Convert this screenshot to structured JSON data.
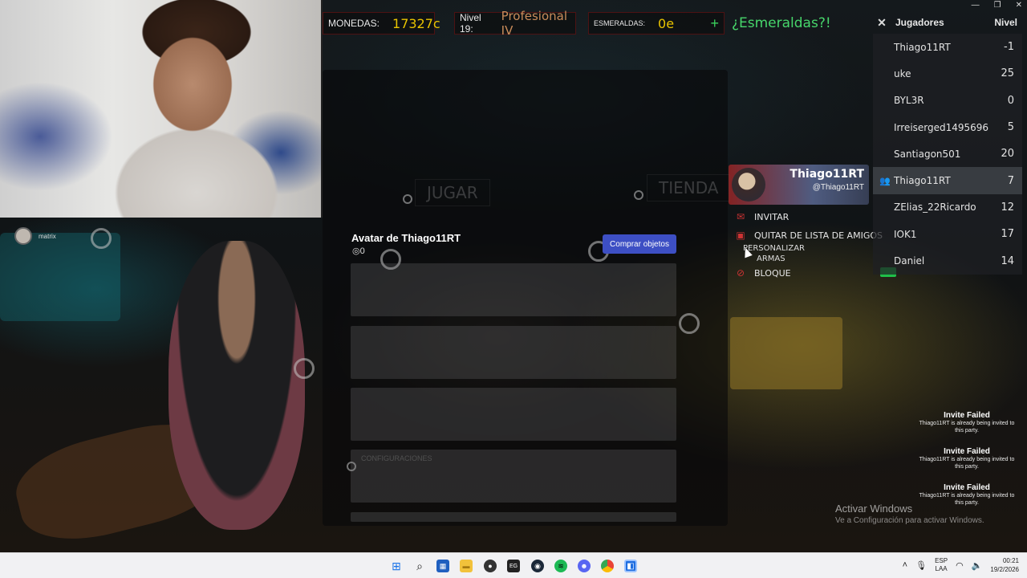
{
  "hud": {
    "coins_label": "MONEDAS:",
    "coins_value": "17327c",
    "level_label": "Nivel 19:",
    "level_rank": "Profesional IV",
    "emeralds_label": "ESMERALDAS:",
    "emeralds_value": "0e",
    "emeralds_plus": "+",
    "emerald_link": "¿Esmeraldas?!"
  },
  "players": {
    "title": "Jugadores",
    "level_header": "Nivel",
    "close": "✕",
    "rows": [
      {
        "name": "Thiago11RT",
        "level": "-1"
      },
      {
        "name": "uke",
        "level": "25"
      },
      {
        "name": "BYL3R",
        "level": "0"
      },
      {
        "name": "Irreiserged1495696",
        "level": "5"
      },
      {
        "name": "Santiagon501",
        "level": "20"
      },
      {
        "name": "Thiago11RT",
        "level": "7"
      },
      {
        "name": "ZElias_22Ricardo",
        "level": "12"
      },
      {
        "name": "IOK1",
        "level": "17"
      },
      {
        "name": "Daniel",
        "level": "14"
      }
    ]
  },
  "menu": {
    "play_tab": "JUGAR",
    "shop_tab": "TIENDA"
  },
  "avatar": {
    "title": "Avatar de Thiago11RT",
    "robux": "◎0",
    "buy_button": "Comprar objetos",
    "settings_caption": "CONFIGURACIONES"
  },
  "profile": {
    "name": "Thiago11RT",
    "handle": "@Thiago11RT",
    "invite": "INVITAR",
    "remove_friend": "QUITAR DE LISTA DE AMIGOS",
    "customize_line1": "PERSONALIZAR",
    "customize_line2": "ARMAS",
    "block": "BLOQUE"
  },
  "stream": {
    "chip_name": "matrix"
  },
  "notifications": [
    {
      "title": "Invite Failed",
      "text": "Thiago11RT is already being invited to this party."
    },
    {
      "title": "Invite Failed",
      "text": "Thiago11RT is already being invited to this party."
    },
    {
      "title": "Invite Failed",
      "text": "Thiago11RT is already being invited to this party."
    }
  ],
  "windows": {
    "activate_title": "Activar Windows",
    "activate_sub": "Ve a Configuración para activar Windows.",
    "lang_top": "ESP",
    "lang_bottom": "LAA",
    "time": "00:21",
    "date": "19/2/2026"
  },
  "colors": {
    "coins": "#e9c400",
    "rank": "#c98c5a",
    "emerald_link": "#47d66b",
    "buy_button": "#3d4fc4"
  }
}
